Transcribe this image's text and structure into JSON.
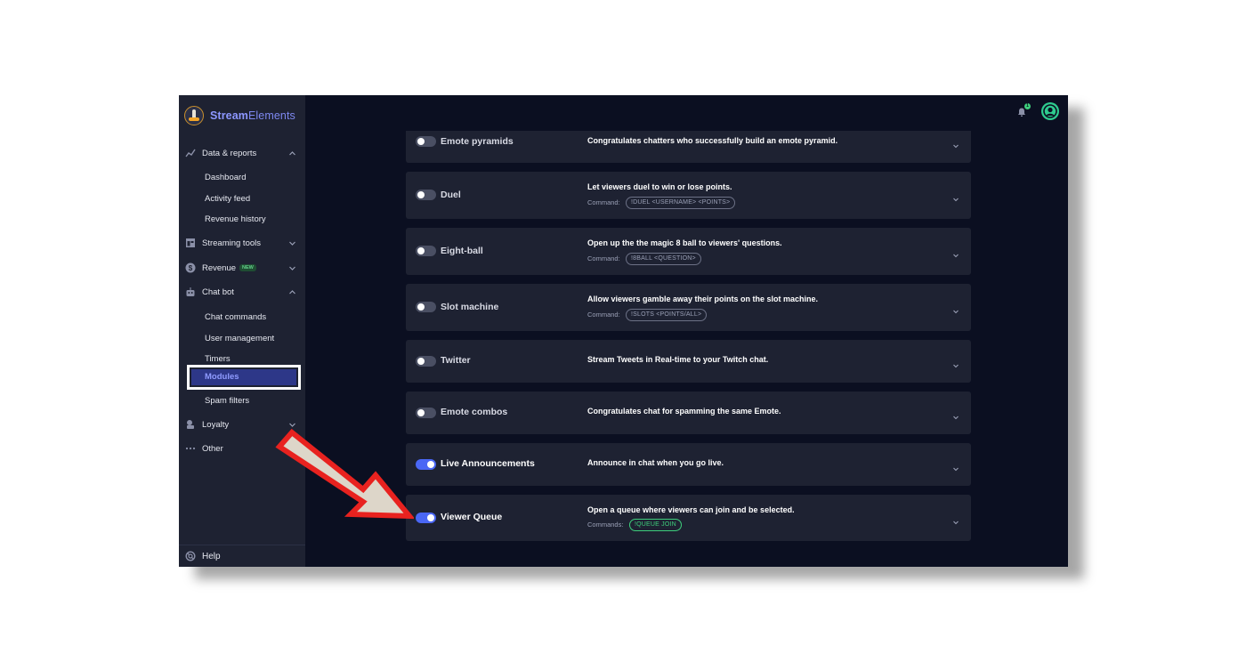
{
  "brand": {
    "name_bold": "Stream",
    "name_rest": "Elements"
  },
  "sidebar": {
    "groups": {
      "data_reports": "Data & reports",
      "dashboard": "Dashboard",
      "activity_feed": "Activity feed",
      "revenue_history": "Revenue history",
      "streaming_tools": "Streaming tools",
      "revenue": "Revenue",
      "revenue_badge": "NEW",
      "chat_bot": "Chat bot",
      "chat_commands": "Chat commands",
      "user_management": "User management",
      "timers": "Timers",
      "modules": "Modules",
      "spam_filters": "Spam filters",
      "loyalty": "Loyalty",
      "other": "Other"
    },
    "help": "Help"
  },
  "topbar": {
    "notification_count": "1"
  },
  "modules": [
    {
      "name": "Emote pyramids",
      "enabled": false,
      "description": "Congratulates chatters who successfully build an emote pyramid."
    },
    {
      "name": "Duel",
      "enabled": false,
      "description": "Let viewers duel to win or lose points.",
      "command_label": "Command:",
      "command": "!DUEL <USERNAME> <POINTS>"
    },
    {
      "name": "Eight-ball",
      "enabled": false,
      "description": "Open up the the magic 8 ball to viewers' questions.",
      "command_label": "Command:",
      "command": "!8BALL <QUESTION>"
    },
    {
      "name": "Slot machine",
      "enabled": false,
      "description": "Allow viewers gamble away their points on the slot machine.",
      "command_label": "Command:",
      "command": "!SLOTS <POINTS/ALL>"
    },
    {
      "name": "Twitter",
      "enabled": false,
      "description": "Stream Tweets in Real-time to your Twitch chat."
    },
    {
      "name": "Emote combos",
      "enabled": false,
      "description": "Congratulates chat for spamming the same Emote."
    },
    {
      "name": "Live Announcements",
      "enabled": true,
      "description": "Announce in chat when you go live."
    },
    {
      "name": "Viewer Queue",
      "enabled": true,
      "description": "Open a queue where viewers can join and be selected.",
      "command_label": "Commands:",
      "command": "!QUEUE JOIN"
    }
  ],
  "colors": {
    "accent": "#4a67f5",
    "highlight": "#ffffff",
    "arrow": "#e8221f",
    "success": "#3ecf7c"
  }
}
